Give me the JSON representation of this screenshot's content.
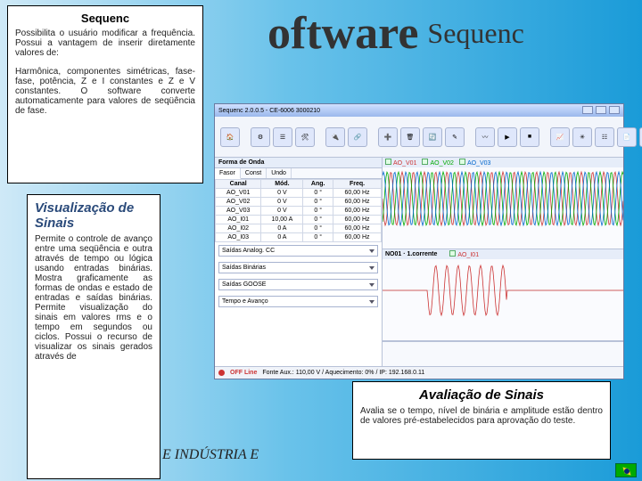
{
  "title": {
    "main": "oftware",
    "sub": "Sequenc"
  },
  "boxes": {
    "sequenc": {
      "heading": "Sequenc",
      "p1": "Possibilita o usuário modificar a frequência. Possui a vantagem de inserir diretamente valores de:",
      "p2": "Harmônica, componentes simétricas, fase-fase, potência, Z e I constantes e Z e V constantes. O software converte automaticamente para valores de seqüência de fase."
    },
    "visual": {
      "heading": "Visualização de Sinais",
      "p1": "Permite o controle de avanço entre uma seqüência e outra através de tempo ou lógica usando entradas binárias. Mostra graficamente as formas de ondas e estado de entradas e saídas binárias. Permite visualização do sinais em valores rms e o tempo em segundos ou ciclos. Possui o recurso de visualizar os sinais gerados através de"
    },
    "avali": {
      "heading": "Avaliação de Sinais",
      "p1": "Avalia se o tempo, nível de binária e amplitude estão dentro de valores pré-estabelecidos para aprovação do teste."
    }
  },
  "app": {
    "title": "Sequenc 2.0.0.5 - CE-6006 3000210",
    "panel_title": "Forma de Onda",
    "tabs": [
      "Fasor",
      "Const",
      "Undo"
    ],
    "grid": {
      "headers": [
        "Canal",
        "Mód.",
        "Ang.",
        "Freq."
      ],
      "rows": [
        [
          "AO_V01",
          "0 V",
          "0 °",
          "60,00 Hz"
        ],
        [
          "AO_V02",
          "0 V",
          "0 °",
          "60,00 Hz"
        ],
        [
          "AO_V03",
          "0 V",
          "0 °",
          "60,00 Hz"
        ],
        [
          "AO_I01",
          "10,00 A",
          "0 °",
          "60,00 Hz"
        ],
        [
          "AO_I02",
          "0 A",
          "0 °",
          "60,00 Hz"
        ],
        [
          "AO_I03",
          "0 A",
          "0 °",
          "60,00 Hz"
        ]
      ]
    },
    "dropdowns": {
      "d1": "Saídas Analog. CC",
      "d2": "Saídas Binárias",
      "d3": "Saídas GOOSE",
      "d4": "Tempo e Avanço"
    },
    "chart1": {
      "s1": "AO_V01",
      "s2": "AO_V02",
      "s3": "AO_V03"
    },
    "chart2_title": "NO01 · 1.corrente",
    "chart2": {
      "s1": "AO_I01"
    },
    "status": {
      "mode": "OFF Line",
      "info": "Fonte Aux.: 110,00 V / Aquecimento: 0% / IP: 192.168.0.11"
    }
  },
  "footer": "E INDÚSTRIA E"
}
